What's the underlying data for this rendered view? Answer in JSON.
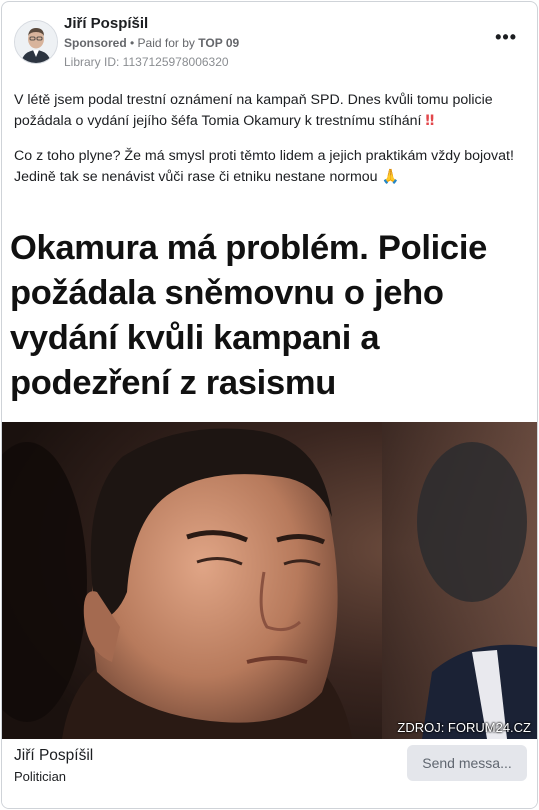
{
  "ad": {
    "advertiser_name": "Jiří Pospíšil",
    "sponsored_label": "Sponsored",
    "paid_for_prefix": "• Paid for by",
    "paid_for_name": "TOP 09",
    "library_id": "Library ID: 1137125978006320",
    "more_label": "•••"
  },
  "post": {
    "paragraph1": "V létě jsem podal trestní oznámení na kampaň SPD. Dnes kvůli tomu policie požádala o vydání jejího šéfa Tomia Okamury k trestnímu stíhání",
    "paragraph1_emoji": "‼",
    "paragraph2": "Co z toho plyne? Že má smysl proti těmto lidem a jejich praktikám vždy bojovat! Jedině tak se nenávist vůči rase či etniku nestane normou",
    "paragraph2_emoji": "🙏",
    "headline": "Okamura má problém. Policie požádala sněmovnu o jeho vydání kvůli kampani a podezření z rasismu",
    "image_source": "ZDROJ: FORUM24.CZ"
  },
  "footer": {
    "page_name": "Jiří Pospíšil",
    "page_category": "Politician",
    "send_message_label": "Send messa..."
  }
}
